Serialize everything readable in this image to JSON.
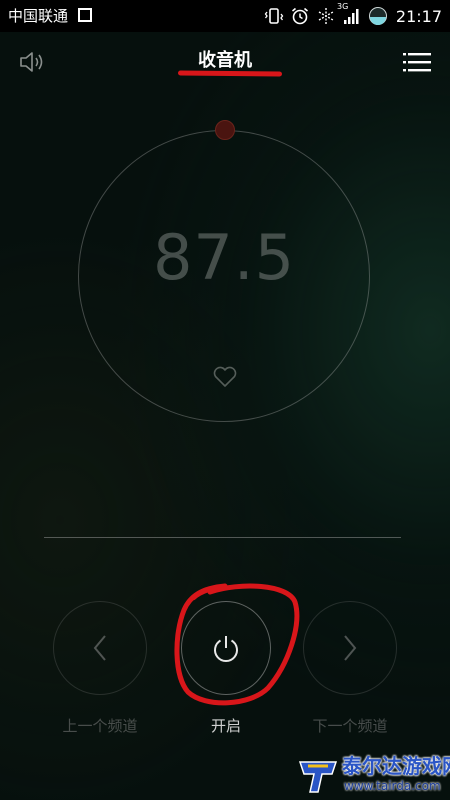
{
  "status_bar": {
    "carrier": "中国联通",
    "network_type": "3G",
    "time": "21:17"
  },
  "header": {
    "title": "收音机"
  },
  "radio": {
    "frequency": "87.5"
  },
  "controls": {
    "prev_label": "上一个频道",
    "power_label": "开启",
    "next_label": "下一个频道"
  },
  "watermark": {
    "site_name": "泰尔达游戏网",
    "url": "www.tairda.com"
  },
  "colors": {
    "accent_red": "#d8161a",
    "background": "#06100d",
    "watermark_blue": "#2a55c6"
  },
  "icons": {
    "gallery": "gallery-icon",
    "vibrate": "vibrate-icon",
    "alarm": "alarm-icon",
    "data": "data-sync-icon",
    "signal": "signal-icon",
    "battery": "battery-icon",
    "speaker": "speaker-icon",
    "menu": "menu-icon",
    "heart": "heart-icon",
    "prev": "chevron-left-icon",
    "power": "power-icon",
    "next": "chevron-right-icon"
  }
}
